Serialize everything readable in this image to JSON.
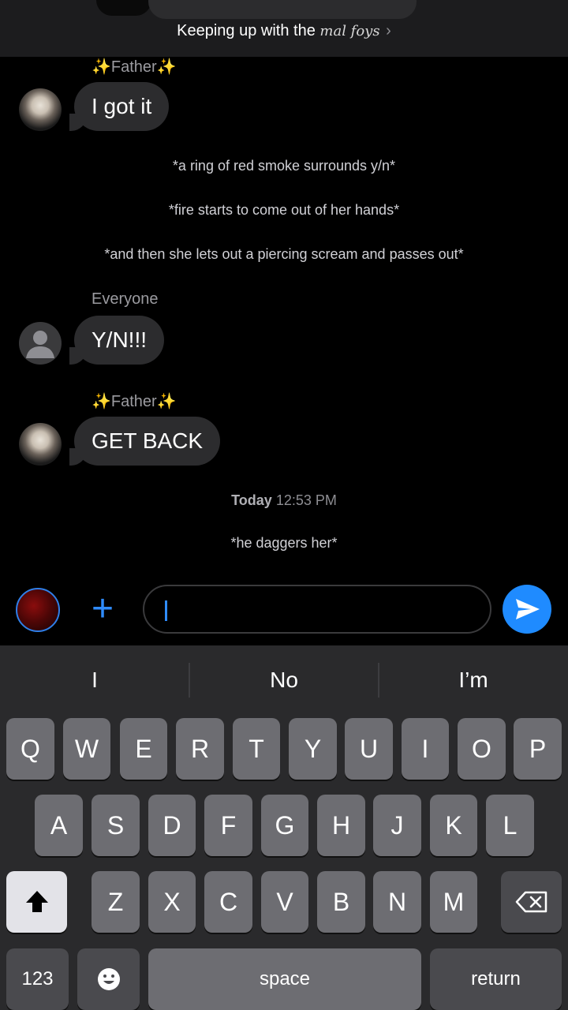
{
  "header": {
    "title_prefix": "Keeping up with the",
    "group_name": "mal foys",
    "chevron": "›"
  },
  "messages": [
    {
      "sender": "✨Father✨",
      "text": "I got it",
      "avatar": "photo"
    },
    {
      "narration": "*a ring of red smoke surrounds y/n*"
    },
    {
      "narration": "*fire starts to come out of her hands*"
    },
    {
      "narration": "*and then she lets out a piercing scream and passes out*"
    },
    {
      "sender": "Everyone",
      "text": "Y/N!!!",
      "avatar": "default-person"
    },
    {
      "sender": "✨Father✨",
      "text": "GET BACK",
      "avatar": "photo"
    },
    {
      "timestamp_day": "Today",
      "timestamp_time": "12:53 PM"
    },
    {
      "narration": "*he daggers her*"
    }
  ],
  "input_bar": {
    "message_value": "",
    "plus_glyph": "+",
    "accent": "#1f8bff"
  },
  "keyboard": {
    "suggestions": [
      "I",
      "No",
      "I’m"
    ],
    "row1": [
      "Q",
      "W",
      "E",
      "R",
      "T",
      "Y",
      "U",
      "I",
      "O",
      "P"
    ],
    "row2": [
      "A",
      "S",
      "D",
      "F",
      "G",
      "H",
      "J",
      "K",
      "L"
    ],
    "row3": [
      "Z",
      "X",
      "C",
      "V",
      "B",
      "N",
      "M"
    ],
    "numbers_label": "123",
    "space_label": "space",
    "return_label": "return"
  }
}
